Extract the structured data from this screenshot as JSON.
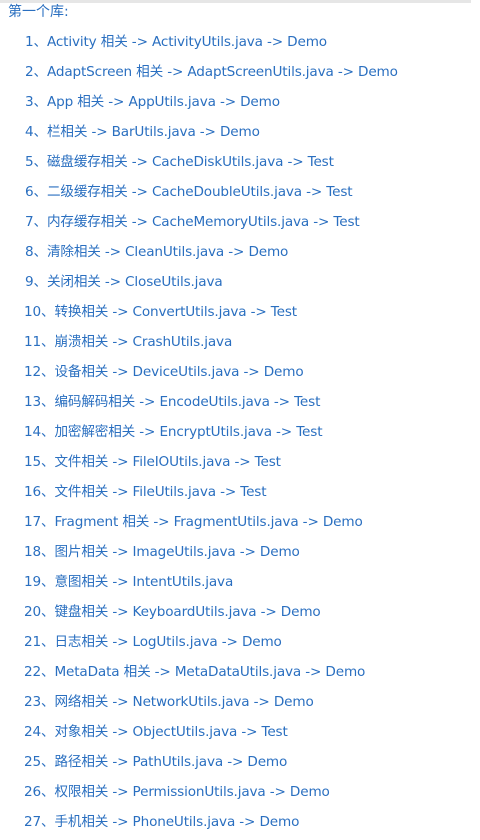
{
  "heading": "第一个库:",
  "items": [
    "1、Activity 相关 -> ActivityUtils.java -> Demo",
    "2、AdaptScreen 相关 -> AdaptScreenUtils.java -> Demo",
    "3、App 相关 -> AppUtils.java -> Demo",
    "4、栏相关 -> BarUtils.java -> Demo",
    "5、磁盘缓存相关 -> CacheDiskUtils.java -> Test",
    "6、二级缓存相关 -> CacheDoubleUtils.java -> Test",
    "7、内存缓存相关 -> CacheMemoryUtils.java -> Test",
    "8、清除相关 -> CleanUtils.java -> Demo",
    "9、关闭相关 -> CloseUtils.java",
    "10、转换相关 -> ConvertUtils.java -> Test",
    "11、崩溃相关 -> CrashUtils.java",
    "12、设备相关 -> DeviceUtils.java -> Demo",
    "13、编码解码相关 -> EncodeUtils.java -> Test",
    "14、加密解密相关 -> EncryptUtils.java -> Test",
    "15、文件相关 -> FileIOUtils.java -> Test",
    "16、文件相关 -> FileUtils.java -> Test",
    "17、Fragment 相关 -> FragmentUtils.java -> Demo",
    "18、图片相关 -> ImageUtils.java -> Demo",
    "19、意图相关 -> IntentUtils.java",
    "20、键盘相关 -> KeyboardUtils.java -> Demo",
    "21、日志相关 -> LogUtils.java -> Demo",
    "22、MetaData 相关 -> MetaDataUtils.java -> Demo",
    "23、网络相关 -> NetworkUtils.java -> Demo",
    "24、对象相关 -> ObjectUtils.java -> Test",
    "25、路径相关 -> PathUtils.java -> Demo",
    "26、权限相关 -> PermissionUtils.java -> Demo",
    "27、手机相关 -> PhoneUtils.java -> Demo"
  ]
}
